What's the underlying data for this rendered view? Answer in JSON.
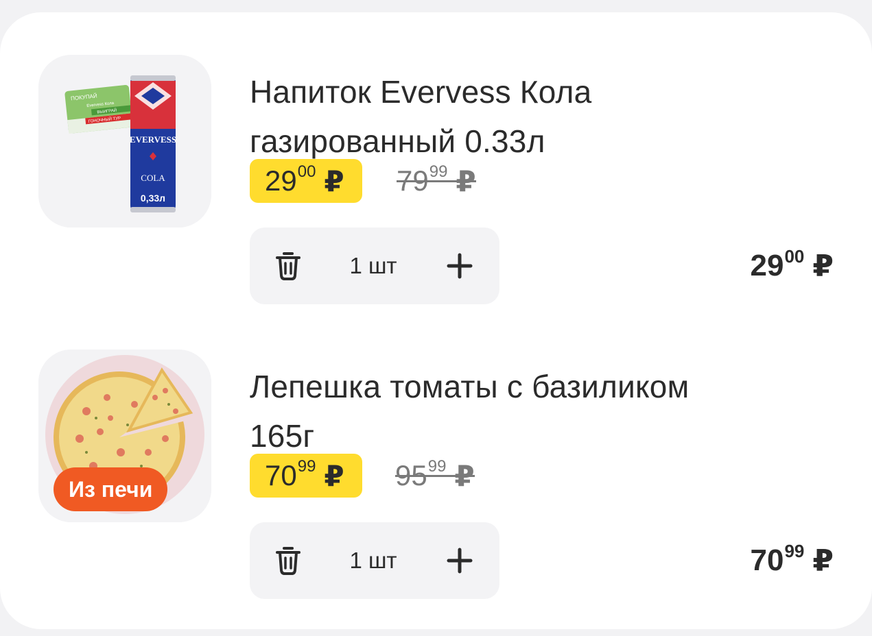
{
  "items": [
    {
      "title_line1": "Напиток Evervess Кола",
      "title_line2": "газированный 0.33л",
      "price_new_int": "29",
      "price_new_dec": "00",
      "price_old_int": "79",
      "price_old_dec": "99",
      "currency": "₽",
      "quantity": "1 шт",
      "total_int": "29",
      "total_dec": "00",
      "image": {
        "icon": "evervess-cola-can-image",
        "can_brand": "EVERVESS",
        "can_label": "COLA",
        "can_volume": "0,33л",
        "promo_card_lines": [
          "ПОКУПАЙ",
          "Evervess Кола",
          "ВЫИГРАЙ",
          "ГОНОЧНЫЙ ТУР"
        ]
      }
    },
    {
      "title_line1": "Лепешка томаты с базиликом",
      "title_line2": "165г",
      "price_new_int": "70",
      "price_new_dec": "99",
      "price_old_int": "95",
      "price_old_dec": "99",
      "currency": "₽",
      "quantity": "1 шт",
      "total_int": "70",
      "total_dec": "99",
      "badge": "Из печи",
      "image": {
        "icon": "flatbread-pizza-image"
      }
    }
  ],
  "colors": {
    "price_highlight": "#ffdc2e",
    "badge_orange": "#f05a23",
    "stepper_bg": "#f3f3f5",
    "page_bg": "#f2f2f4"
  },
  "icons": {
    "remove": "trash-icon",
    "add": "plus-icon"
  }
}
